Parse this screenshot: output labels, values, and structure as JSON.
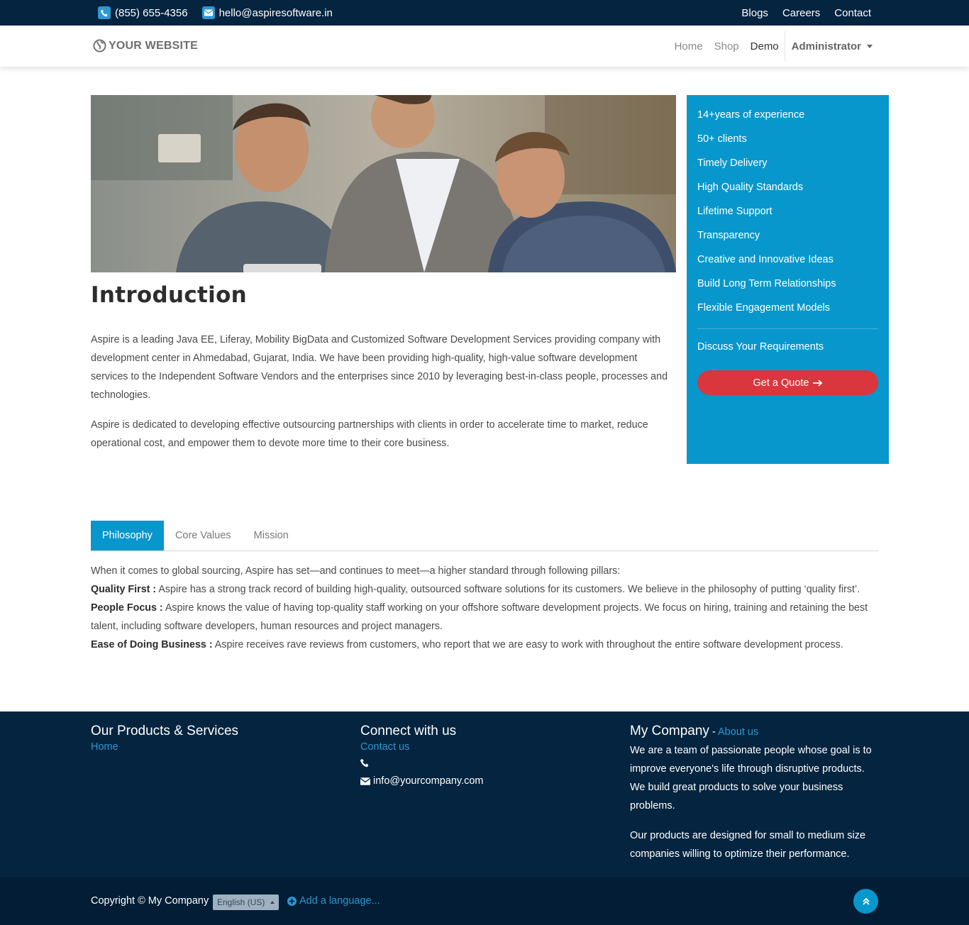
{
  "topbar": {
    "phone": "(855) 655-4356",
    "email": "hello@aspiresoftware.in",
    "links": [
      "Blogs",
      "Careers",
      "Contact"
    ]
  },
  "navbar": {
    "logo_text": "YOUR WEBSITE",
    "links": [
      "Home",
      "Shop",
      "Demo"
    ],
    "admin": "Administrator"
  },
  "intro": {
    "title": "Introduction",
    "p1": "Aspire is a leading Java EE, Liferay, Mobility BigData and Customized Software Development Services providing company with development center in Ahmedabad, Gujarat, India. We have been providing high-quality, high-value software development services to the Independent Software Vendors and the enterprises since 2010 by leveraging best-in-class people, processes and technologies.",
    "p2": "Aspire is dedicated to developing effective outsourcing partnerships with clients in order to accelerate time to market, reduce operational cost, and empower them to devote more time to their core business."
  },
  "sidebar": {
    "items": [
      "14+years of experience",
      "50+ clients",
      "Timely Delivery",
      "High Quality Standards",
      "Lifetime Support",
      "Transparency",
      "Creative and Innovative Ideas",
      "Build Long Term Relationships",
      "Flexible Engagement Models"
    ],
    "discuss": "Discuss Your Requirements",
    "quote_label": "Get a Quote"
  },
  "tabs": {
    "labels": [
      "Philosophy",
      "Core Values",
      "Mission"
    ],
    "intro": "When it comes to global sourcing, Aspire has set—and continues to meet—a higher standard through following pillars:",
    "pillars": [
      {
        "title": "Quality First :",
        "text": " Aspire has a strong track record of building high-quality, outsourced software solutions for its customers. We believe in the philosophy of putting ‘quality first’."
      },
      {
        "title": "People Focus :",
        "text": " Aspire knows the value of having top-quality staff working on your offshore software development projects. We focus on hiring, training and retaining the best talent, including software developers, human resources and project managers."
      },
      {
        "title": "Ease of Doing Business :",
        "text": " Aspire receives rave reviews from customers, who report that we are easy to work with throughout the entire software development process."
      }
    ]
  },
  "footer": {
    "col1": {
      "title": "Our Products & Services",
      "link": "Home"
    },
    "col2": {
      "title": "Connect with us",
      "link": "Contact us",
      "email": "info@yourcompany.com"
    },
    "col3": {
      "title": "My Company",
      "dash": " - ",
      "link": "About us",
      "p1": "We are a team of passionate people whose goal is to improve everyone's life through disruptive products. We build great products to solve your business problems.",
      "p2": "Our products are designed for small to medium size companies willing to optimize their performance."
    }
  },
  "bottom": {
    "copyright": "Copyright © My Company",
    "language": "English (US)",
    "add_language": "Add a language..."
  },
  "colors": {
    "dark_navy": "#04243f",
    "accent_blue": "#0897cc",
    "quote_red": "#d9363e",
    "link_blue": "#2f97d1"
  }
}
